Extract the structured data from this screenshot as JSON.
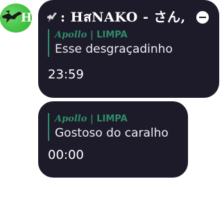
{
  "colors": {
    "bubble": "#1d1b2a",
    "quote_accent": "#2f8c69",
    "avatar": "#44c244",
    "background": "#ffffff"
  },
  "avatar": {
    "letter": "H",
    "icon": "bird-icon"
  },
  "messages": [
    {
      "sender": ": HสNAKO - さん,",
      "reply": {
        "author": "Apollo",
        "separator": "|",
        "tag": "LIMPA",
        "text": "Esse desgraçadinho"
      },
      "time": "23:59"
    },
    {
      "reply": {
        "author": "Apollo",
        "separator": "|",
        "tag": "LIMPA",
        "text": "Gostoso do caralho"
      },
      "time": "00:00"
    }
  ]
}
